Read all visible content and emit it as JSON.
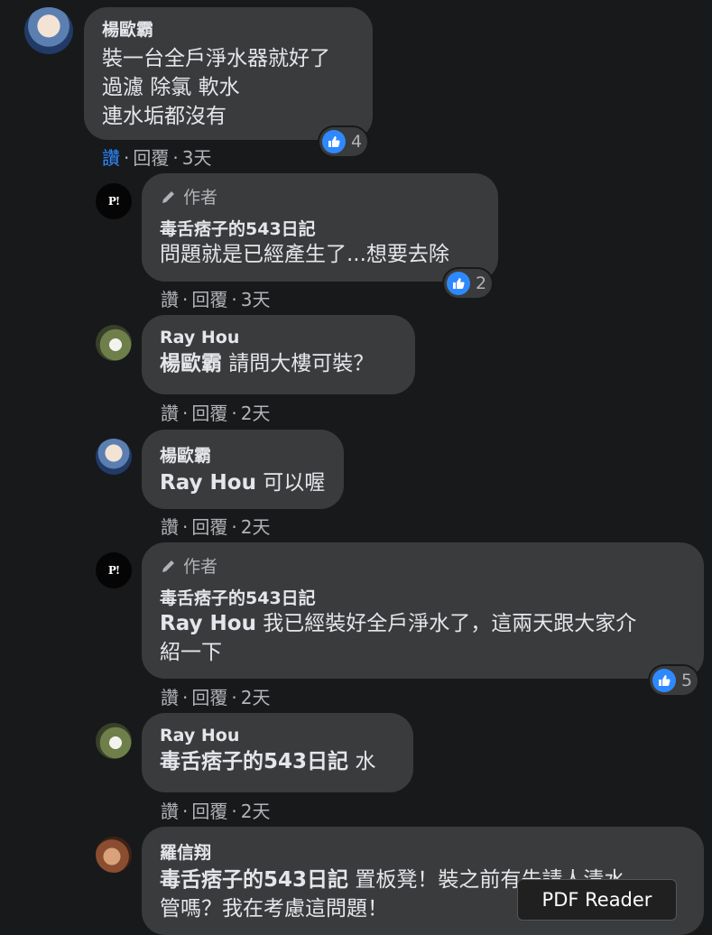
{
  "comments": [
    {
      "author": "楊歐霸",
      "lines": [
        "裝一台全戶淨水器就好了",
        "過濾 除氯 軟水",
        "連水垢都沒有"
      ],
      "actions": {
        "like": "讚",
        "reply": "回覆",
        "time": "3天"
      },
      "reactions": "4"
    },
    {
      "badge": "作者",
      "author": "毒舌痞子的543日記",
      "text": "問題就是已經產生了...想要去除",
      "actions": {
        "like": "讚",
        "reply": "回覆",
        "time": "3天"
      },
      "reactions": "2",
      "avatar_text": "P!"
    },
    {
      "author": "Ray Hou",
      "tag": "楊歐霸",
      "text": " 請問大樓可裝？",
      "actions": {
        "like": "讚",
        "reply": "回覆",
        "time": "2天"
      }
    },
    {
      "author": "楊歐霸",
      "tag": "Ray Hou",
      "text": " 可以喔",
      "actions": {
        "like": "讚",
        "reply": "回覆",
        "time": "2天"
      }
    },
    {
      "badge": "作者",
      "author": "毒舌痞子的543日記",
      "tag": "Ray Hou",
      "text": " 我已經裝好全戶淨水了，這兩天跟大家介",
      "text2": "紹一下",
      "actions": {
        "like": "讚",
        "reply": "回覆",
        "time": "2天"
      },
      "reactions": "5",
      "avatar_text": "P!"
    },
    {
      "author": "Ray Hou",
      "tag": "毒舌痞子的543日記",
      "text": " 水",
      "actions": {
        "like": "讚",
        "reply": "回覆",
        "time": "2天"
      }
    },
    {
      "author": "羅信翔",
      "tag": "毒舌痞子的543日記",
      "text": " 置板凳！裝之前有先請人清水",
      "text2": "管嗎？我在考慮這問題！"
    }
  ],
  "separator": "·",
  "pdf_reader": "PDF Reader",
  "colors": {
    "background": "#18191a",
    "bubble": "#3a3b3c",
    "like_blue": "#2e89ff",
    "meta": "#b0b3b8"
  }
}
